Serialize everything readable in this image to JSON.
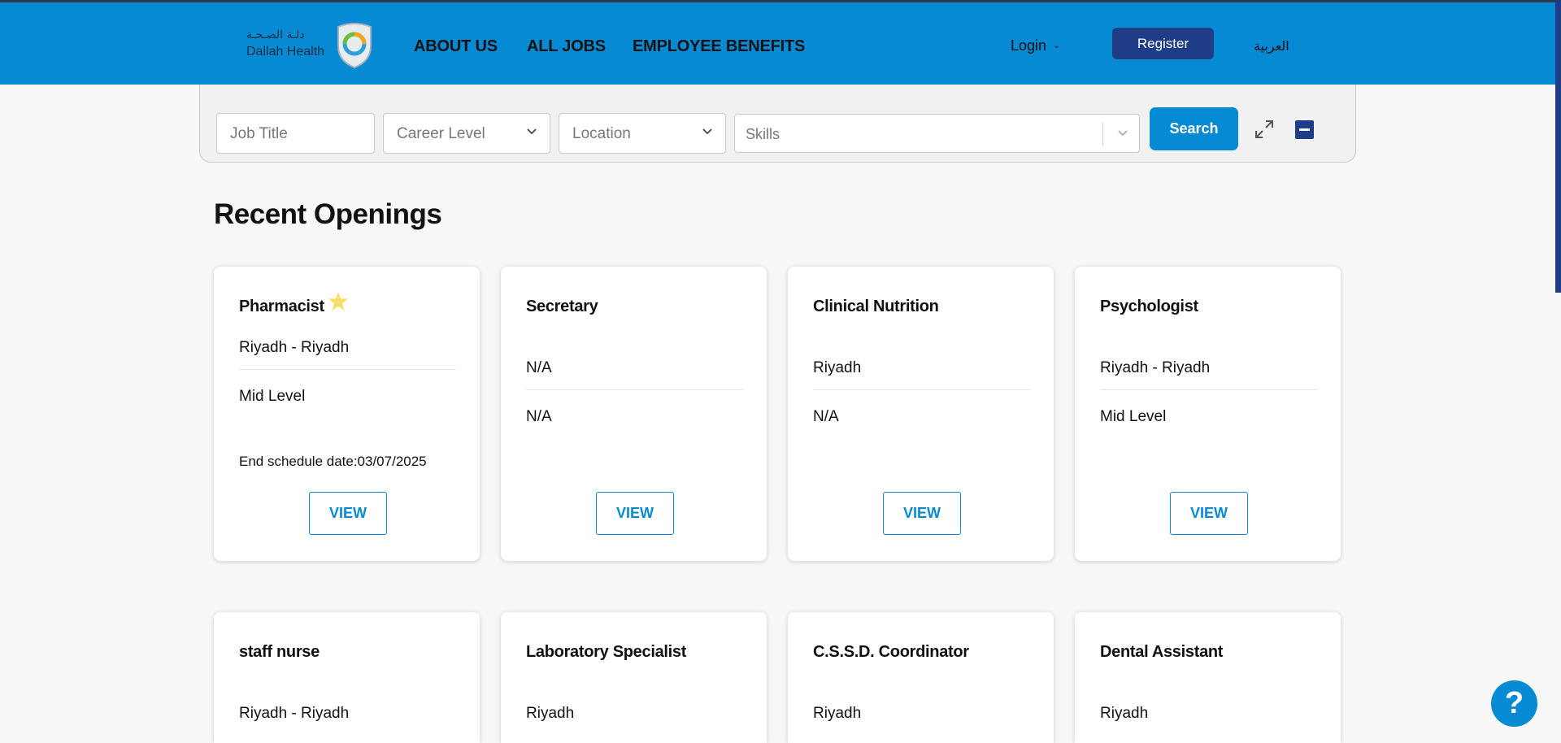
{
  "brand": {
    "name_ar": "دلـة الصـحـة",
    "name_en": "Dallah Health"
  },
  "nav": {
    "about": "ABOUT US",
    "jobs": "ALL JOBS",
    "benefits": "EMPLOYEE BENEFITS"
  },
  "header": {
    "login": "Login",
    "register": "Register",
    "lang": "العربية"
  },
  "search": {
    "job_title_placeholder": "Job Title",
    "career_level": "Career Level",
    "location": "Location",
    "skills": "Skills",
    "button": "Search"
  },
  "section_title": "Recent Openings",
  "jobs": [
    {
      "title": "Pharmacist",
      "featured": true,
      "location": "Riyadh - Riyadh",
      "level": "Mid Level",
      "schedule": "End schedule date:03/07/2025",
      "view": "VIEW"
    },
    {
      "title": "Secretary",
      "location": "N/A",
      "level": "N/A",
      "view": "VIEW"
    },
    {
      "title": "Clinical Nutrition",
      "location": "Riyadh",
      "level": "N/A",
      "view": "VIEW"
    },
    {
      "title": "Psychologist",
      "location": "Riyadh - Riyadh",
      "level": "Mid Level",
      "view": "VIEW"
    },
    {
      "title": "staff nurse",
      "location": "Riyadh - Riyadh"
    },
    {
      "title": "Laboratory Specialist",
      "location": "Riyadh"
    },
    {
      "title": "C.S.S.D. Coordinator",
      "location": "Riyadh"
    },
    {
      "title": "Dental Assistant",
      "location": "Riyadh"
    }
  ],
  "help": "?",
  "colors": {
    "primary": "#078ad4",
    "navy": "#1f3c87",
    "star": "#f7e06a"
  }
}
